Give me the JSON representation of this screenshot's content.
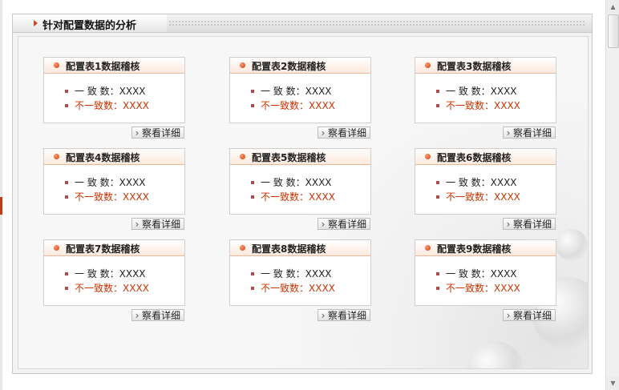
{
  "panel": {
    "title": "针对配置数据的分析"
  },
  "cards": [
    {
      "title": "配置表1数据稽核",
      "consistent_label": "一 致 数：",
      "consistent_value": "XXXX",
      "inconsistent_label": "不一致数：",
      "inconsistent_value": "XXXX",
      "detail_label": "察看详细"
    },
    {
      "title": "配置表2数据稽核",
      "consistent_label": "一 致 数：",
      "consistent_value": "XXXX",
      "inconsistent_label": "不一致数：",
      "inconsistent_value": "XXXX",
      "detail_label": "察看详细"
    },
    {
      "title": "配置表3数据稽核",
      "consistent_label": "一 致 数：",
      "consistent_value": "XXXX",
      "inconsistent_label": "不一致数：",
      "inconsistent_value": "XXXX",
      "detail_label": "察看详细"
    },
    {
      "title": "配置表4数据稽核",
      "consistent_label": "一 致 数：",
      "consistent_value": "XXXX",
      "inconsistent_label": "不一致数：",
      "inconsistent_value": "XXXX",
      "detail_label": "察看详细"
    },
    {
      "title": "配置表5数据稽核",
      "consistent_label": "一 致 数：",
      "consistent_value": "XXXX",
      "inconsistent_label": "不一致数：",
      "inconsistent_value": "XXXX",
      "detail_label": "察看详细"
    },
    {
      "title": "配置表6数据稽核",
      "consistent_label": "一 致 数：",
      "consistent_value": "XXXX",
      "inconsistent_label": "不一致数：",
      "inconsistent_value": "XXXX",
      "detail_label": "察看详细"
    },
    {
      "title": "配置表7数据稽核",
      "consistent_label": "一 致 数：",
      "consistent_value": "XXXX",
      "inconsistent_label": "不一致数：",
      "inconsistent_value": "XXXX",
      "detail_label": "察看详细"
    },
    {
      "title": "配置表8数据稽核",
      "consistent_label": "一 致 数：",
      "consistent_value": "XXXX",
      "inconsistent_label": "不一致数：",
      "inconsistent_value": "XXXX",
      "detail_label": "察看详细"
    },
    {
      "title": "配置表9数据稽核",
      "consistent_label": "一 致 数：",
      "consistent_value": "XXXX",
      "inconsistent_label": "不一致数：",
      "inconsistent_value": "XXXX",
      "detail_label": "察看详细"
    }
  ],
  "colors": {
    "accent": "#d2461a",
    "inconsistent_text": "#cc3300",
    "card_header_bg": "#fde9dc"
  },
  "icons": {
    "title_marker": "arrow-right-icon",
    "card_marker": "orange-dot-icon",
    "row_bullet": "square-bullet-icon",
    "detail_button": "chevron-right-icon"
  }
}
